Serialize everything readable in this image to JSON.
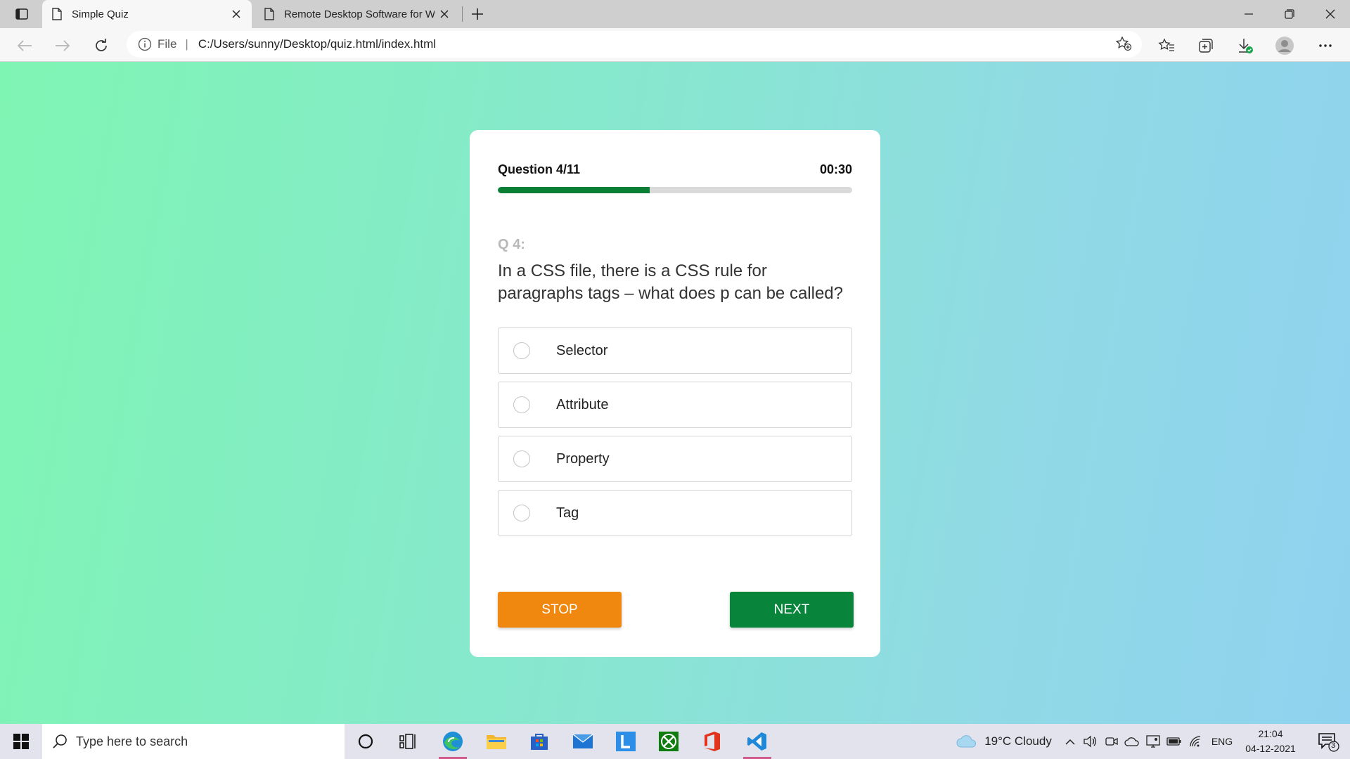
{
  "browser": {
    "tabs": [
      {
        "title": "Simple Quiz"
      },
      {
        "title": "Remote Desktop Software for W"
      }
    ],
    "address": {
      "protocol": "File",
      "url": "C:/Users/sunny/Desktop/quiz.html/index.html"
    }
  },
  "quiz": {
    "progress_label": "Question 4/11",
    "timer": "00:30",
    "progress_fraction": 0.4286,
    "question_number": "Q 4:",
    "question_text": "In a CSS file, there is a CSS rule for paragraphs tags – what does p can be called?",
    "options": [
      {
        "label": "Selector"
      },
      {
        "label": "Attribute"
      },
      {
        "label": "Property"
      },
      {
        "label": "Tag"
      }
    ],
    "stop_label": "STOP",
    "next_label": "NEXT"
  },
  "colors": {
    "progress": "#0b7f35",
    "stop": "#f0880f",
    "next": "#08843b"
  },
  "taskbar": {
    "search_placeholder": "Type here to search",
    "weather": "19°C  Cloudy",
    "language": "ENG",
    "time": "21:04",
    "date": "04-12-2021",
    "notification_count": "3"
  }
}
